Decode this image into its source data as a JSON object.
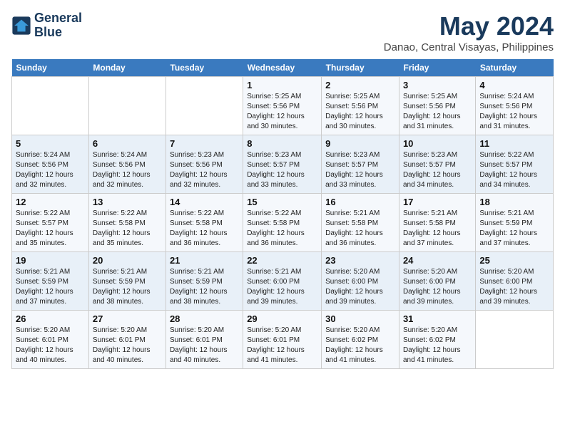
{
  "header": {
    "logo_line1": "General",
    "logo_line2": "Blue",
    "title": "May 2024",
    "subtitle": "Danao, Central Visayas, Philippines"
  },
  "days_of_week": [
    "Sunday",
    "Monday",
    "Tuesday",
    "Wednesday",
    "Thursday",
    "Friday",
    "Saturday"
  ],
  "weeks": [
    [
      {
        "day": "",
        "info": ""
      },
      {
        "day": "",
        "info": ""
      },
      {
        "day": "",
        "info": ""
      },
      {
        "day": "1",
        "info": "Sunrise: 5:25 AM\nSunset: 5:56 PM\nDaylight: 12 hours\nand 30 minutes."
      },
      {
        "day": "2",
        "info": "Sunrise: 5:25 AM\nSunset: 5:56 PM\nDaylight: 12 hours\nand 30 minutes."
      },
      {
        "day": "3",
        "info": "Sunrise: 5:25 AM\nSunset: 5:56 PM\nDaylight: 12 hours\nand 31 minutes."
      },
      {
        "day": "4",
        "info": "Sunrise: 5:24 AM\nSunset: 5:56 PM\nDaylight: 12 hours\nand 31 minutes."
      }
    ],
    [
      {
        "day": "5",
        "info": "Sunrise: 5:24 AM\nSunset: 5:56 PM\nDaylight: 12 hours\nand 32 minutes."
      },
      {
        "day": "6",
        "info": "Sunrise: 5:24 AM\nSunset: 5:56 PM\nDaylight: 12 hours\nand 32 minutes."
      },
      {
        "day": "7",
        "info": "Sunrise: 5:23 AM\nSunset: 5:56 PM\nDaylight: 12 hours\nand 32 minutes."
      },
      {
        "day": "8",
        "info": "Sunrise: 5:23 AM\nSunset: 5:57 PM\nDaylight: 12 hours\nand 33 minutes."
      },
      {
        "day": "9",
        "info": "Sunrise: 5:23 AM\nSunset: 5:57 PM\nDaylight: 12 hours\nand 33 minutes."
      },
      {
        "day": "10",
        "info": "Sunrise: 5:23 AM\nSunset: 5:57 PM\nDaylight: 12 hours\nand 34 minutes."
      },
      {
        "day": "11",
        "info": "Sunrise: 5:22 AM\nSunset: 5:57 PM\nDaylight: 12 hours\nand 34 minutes."
      }
    ],
    [
      {
        "day": "12",
        "info": "Sunrise: 5:22 AM\nSunset: 5:57 PM\nDaylight: 12 hours\nand 35 minutes."
      },
      {
        "day": "13",
        "info": "Sunrise: 5:22 AM\nSunset: 5:58 PM\nDaylight: 12 hours\nand 35 minutes."
      },
      {
        "day": "14",
        "info": "Sunrise: 5:22 AM\nSunset: 5:58 PM\nDaylight: 12 hours\nand 36 minutes."
      },
      {
        "day": "15",
        "info": "Sunrise: 5:22 AM\nSunset: 5:58 PM\nDaylight: 12 hours\nand 36 minutes."
      },
      {
        "day": "16",
        "info": "Sunrise: 5:21 AM\nSunset: 5:58 PM\nDaylight: 12 hours\nand 36 minutes."
      },
      {
        "day": "17",
        "info": "Sunrise: 5:21 AM\nSunset: 5:58 PM\nDaylight: 12 hours\nand 37 minutes."
      },
      {
        "day": "18",
        "info": "Sunrise: 5:21 AM\nSunset: 5:59 PM\nDaylight: 12 hours\nand 37 minutes."
      }
    ],
    [
      {
        "day": "19",
        "info": "Sunrise: 5:21 AM\nSunset: 5:59 PM\nDaylight: 12 hours\nand 37 minutes."
      },
      {
        "day": "20",
        "info": "Sunrise: 5:21 AM\nSunset: 5:59 PM\nDaylight: 12 hours\nand 38 minutes."
      },
      {
        "day": "21",
        "info": "Sunrise: 5:21 AM\nSunset: 5:59 PM\nDaylight: 12 hours\nand 38 minutes."
      },
      {
        "day": "22",
        "info": "Sunrise: 5:21 AM\nSunset: 6:00 PM\nDaylight: 12 hours\nand 39 minutes."
      },
      {
        "day": "23",
        "info": "Sunrise: 5:20 AM\nSunset: 6:00 PM\nDaylight: 12 hours\nand 39 minutes."
      },
      {
        "day": "24",
        "info": "Sunrise: 5:20 AM\nSunset: 6:00 PM\nDaylight: 12 hours\nand 39 minutes."
      },
      {
        "day": "25",
        "info": "Sunrise: 5:20 AM\nSunset: 6:00 PM\nDaylight: 12 hours\nand 39 minutes."
      }
    ],
    [
      {
        "day": "26",
        "info": "Sunrise: 5:20 AM\nSunset: 6:01 PM\nDaylight: 12 hours\nand 40 minutes."
      },
      {
        "day": "27",
        "info": "Sunrise: 5:20 AM\nSunset: 6:01 PM\nDaylight: 12 hours\nand 40 minutes."
      },
      {
        "day": "28",
        "info": "Sunrise: 5:20 AM\nSunset: 6:01 PM\nDaylight: 12 hours\nand 40 minutes."
      },
      {
        "day": "29",
        "info": "Sunrise: 5:20 AM\nSunset: 6:01 PM\nDaylight: 12 hours\nand 41 minutes."
      },
      {
        "day": "30",
        "info": "Sunrise: 5:20 AM\nSunset: 6:02 PM\nDaylight: 12 hours\nand 41 minutes."
      },
      {
        "day": "31",
        "info": "Sunrise: 5:20 AM\nSunset: 6:02 PM\nDaylight: 12 hours\nand 41 minutes."
      },
      {
        "day": "",
        "info": ""
      }
    ]
  ]
}
